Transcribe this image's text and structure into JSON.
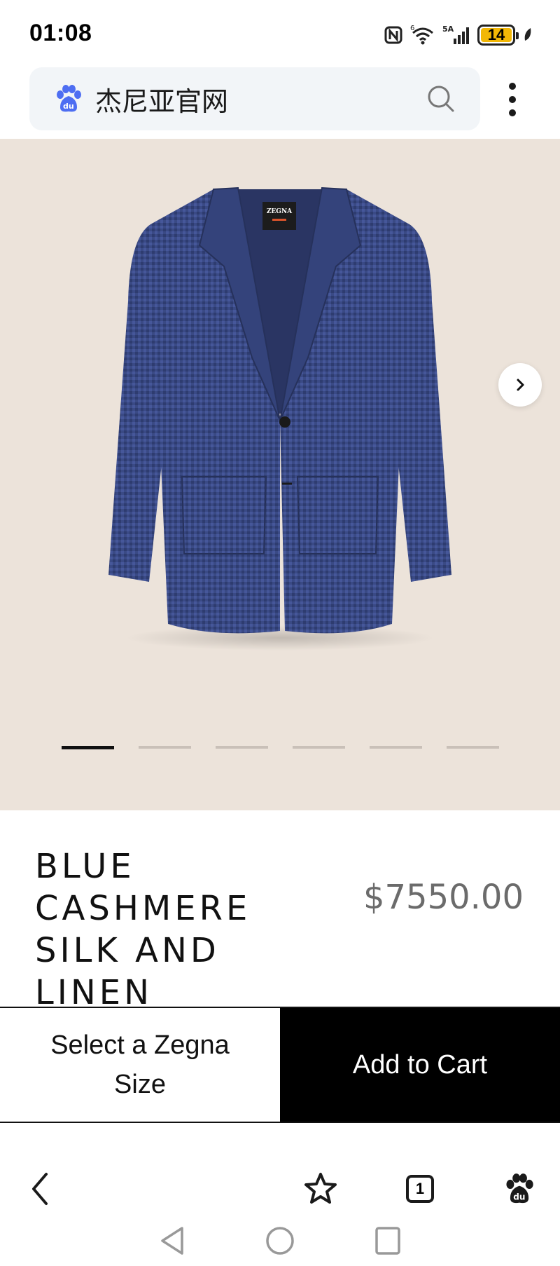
{
  "status_bar": {
    "time": "01:08",
    "network_label": "5A",
    "wifi_label": "6",
    "battery_level": "14"
  },
  "search_bar": {
    "query": "杰尼亚官网",
    "logo_icon": "baidu-paw-icon"
  },
  "hero": {
    "jacket_label": "ZEGNA",
    "image_count": 6,
    "active_index": 0,
    "next_icon": "chevron-right-icon"
  },
  "product": {
    "title": "BLUE CASHMERE SILK AND LINEN",
    "price": "$7550.00"
  },
  "actions": {
    "size_label": "Select a Zegna Size",
    "cart_label": "Add to Cart"
  },
  "bottom_nav": {
    "tab_count": "1",
    "icons": [
      "back-icon",
      "star-icon",
      "tabs-icon",
      "baidu-icon"
    ]
  },
  "colors": {
    "hero_bg": "#ece3da",
    "jacket": "#3a4a85",
    "price": "#6b6b6b",
    "cart_bg": "#000000",
    "baidu_blue": "#3b5bdb"
  }
}
